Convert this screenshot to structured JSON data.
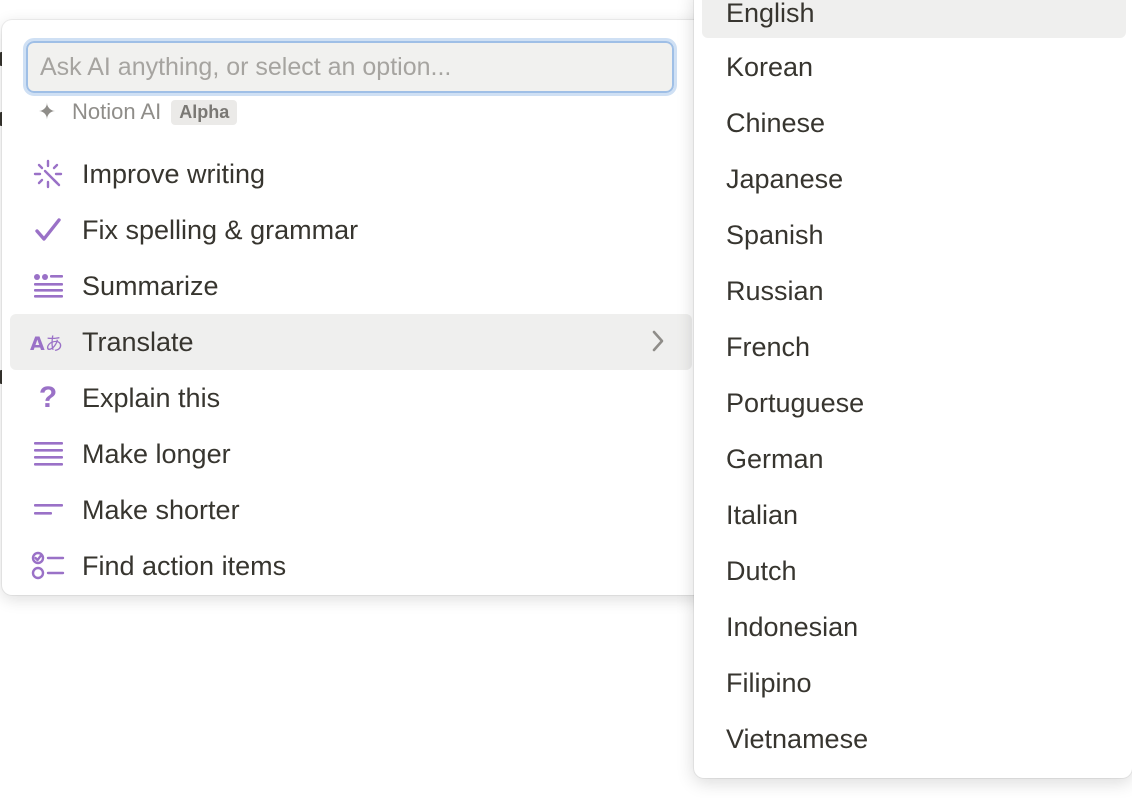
{
  "input": {
    "placeholder": "Ask AI anything, or select an option..."
  },
  "section": {
    "title": "Notion AI",
    "badge": "Alpha"
  },
  "menu": {
    "items": [
      {
        "label": "Improve writing",
        "icon": "sparkle-wand-icon"
      },
      {
        "label": "Fix spelling & grammar",
        "icon": "checkmark-icon"
      },
      {
        "label": "Summarize",
        "icon": "quote-lines-icon"
      },
      {
        "label": "Translate",
        "icon": "translate-icon",
        "active": true,
        "has_submenu": true
      },
      {
        "label": "Explain this",
        "icon": "question-mark-icon"
      },
      {
        "label": "Make longer",
        "icon": "lines-long-icon"
      },
      {
        "label": "Make shorter",
        "icon": "lines-short-icon"
      },
      {
        "label": "Find action items",
        "icon": "checklist-icon"
      }
    ]
  },
  "languages": {
    "items": [
      "English",
      "Korean",
      "Chinese",
      "Japanese",
      "Spanish",
      "Russian",
      "French",
      "Portuguese",
      "German",
      "Italian",
      "Dutch",
      "Indonesian",
      "Filipino",
      "Vietnamese"
    ],
    "highlighted": "English"
  },
  "colors": {
    "accent_icon": "#9a71c7",
    "hover_bg": "#efefee",
    "input_focus_border": "#9fbfe6"
  }
}
